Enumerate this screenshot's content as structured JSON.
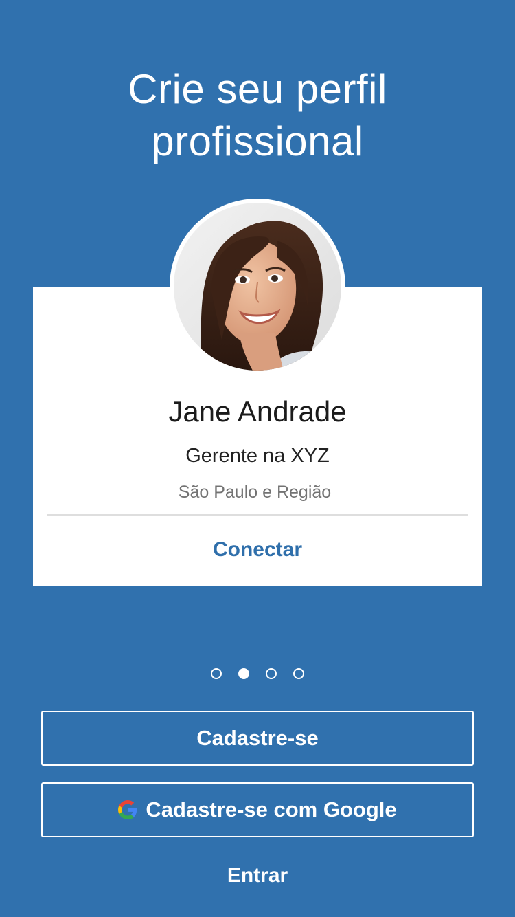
{
  "onboarding": {
    "headline_line1": "Crie seu perfil",
    "headline_line2": "profissional"
  },
  "profile_card": {
    "name": "Jane Andrade",
    "job_title": "Gerente na XYZ",
    "location": "São Paulo e Região",
    "connect_label": "Conectar",
    "avatar_icon": "profile-photo"
  },
  "pagination": {
    "total": 4,
    "active_index": 1
  },
  "actions": {
    "signup_label": "Cadastre-se",
    "google_signup_label": "Cadastre-se com Google",
    "google_icon": "google-icon",
    "signin_label": "Entrar"
  },
  "colors": {
    "background": "#3071ae",
    "accent": "#2f6fab",
    "card": "#ffffff"
  }
}
